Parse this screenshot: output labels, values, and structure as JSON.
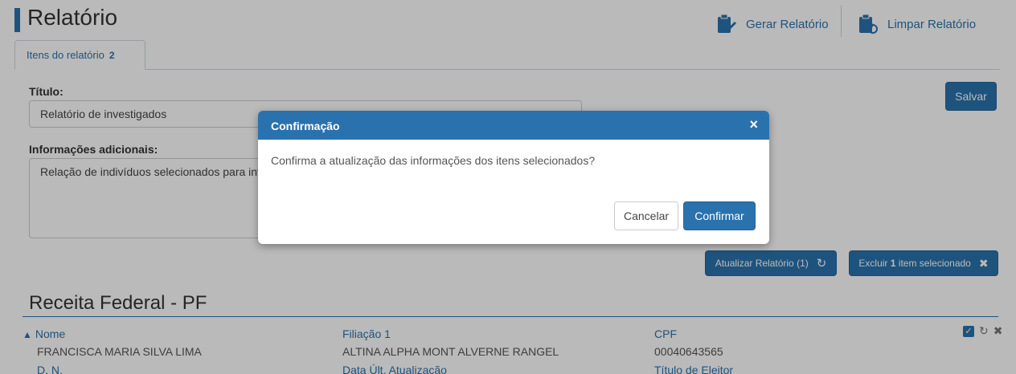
{
  "header": {
    "title": "Relatório",
    "generate_label": "Gerar Relatório",
    "clear_label": "Limpar Relatório",
    "generate_icon": "clipboard-check-icon",
    "clear_icon": "clipboard-refresh-icon"
  },
  "tab": {
    "label": "Itens do relatório",
    "count": "2"
  },
  "form": {
    "title_label": "Título:",
    "title_value": "Relatório de investigados",
    "info_label": "Informações adicionais:",
    "info_value": "Relação de indivíduos selecionados para inv",
    "save_label": "Salvar"
  },
  "actions": {
    "update_label": "Atualizar Relatório (1)",
    "update_icon": "refresh-icon",
    "delete_prefix": "Excluir",
    "delete_count": "1",
    "delete_suffix": "item selecionado",
    "delete_icon": "close-icon"
  },
  "section": {
    "title": "Receita Federal - PF",
    "headers": [
      "Nome",
      "Filiação 1",
      "CPF"
    ],
    "row": [
      "FRANCISCA MARIA SILVA LIMA",
      "ALTINA ALPHA MONT ALVERNE RANGEL",
      "00040643565"
    ],
    "headers2": [
      "D. N.",
      "Data Últ. Atualização",
      "Título de Eleitor"
    ]
  },
  "modal": {
    "title": "Confirmação",
    "message": "Confirma a atualização das informações dos itens selecionados?",
    "cancel_label": "Cancelar",
    "confirm_label": "Confirmar"
  },
  "colors": {
    "accent": "#2a72ad",
    "overlay": "rgba(0,0,0,0.27)"
  }
}
